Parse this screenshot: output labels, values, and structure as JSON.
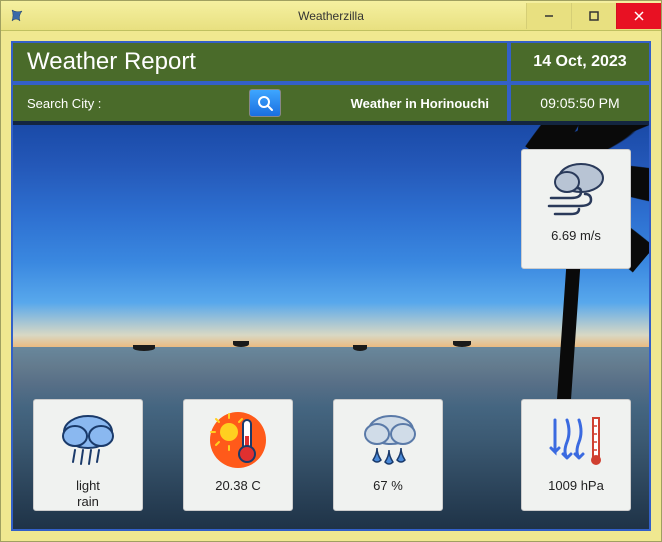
{
  "window": {
    "title": "Weatherzilla"
  },
  "header": {
    "title": "Weather Report",
    "date": "14 Oct, 2023"
  },
  "search": {
    "label": "Search City :",
    "value": "",
    "location": "Weather in Horinouchi",
    "time": "09:05:50 PM"
  },
  "cards": {
    "wind": {
      "value": "6.69 m/s"
    },
    "condition": {
      "value": "light\nrain"
    },
    "temp": {
      "value": "20.38 C"
    },
    "humidity": {
      "value": "67 %"
    },
    "pressure": {
      "value": "1009 hPa"
    }
  }
}
